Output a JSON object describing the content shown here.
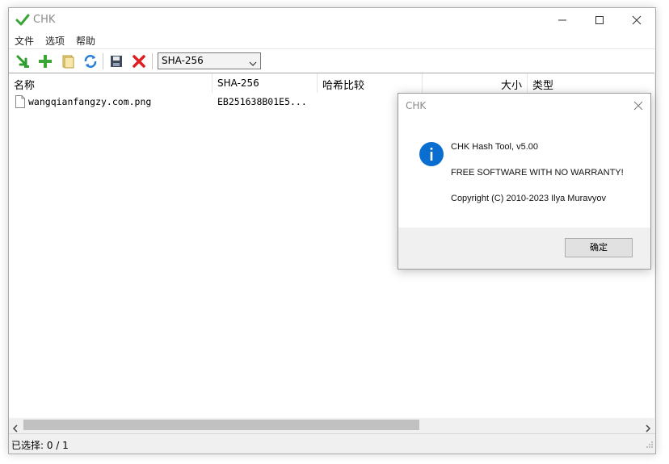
{
  "window": {
    "title": "CHK"
  },
  "menu": {
    "items": [
      "文件",
      "选项",
      "帮助"
    ]
  },
  "toolbar": {
    "buttons": [
      "open-icon",
      "add-icon",
      "folder-icon",
      "refresh-icon",
      "save-icon",
      "delete-icon"
    ],
    "algorithm_selected": "SHA-256"
  },
  "list": {
    "columns": [
      "名称",
      "SHA-256",
      "哈希比较",
      "大小",
      "类型"
    ],
    "rows": [
      {
        "name": "wangqianfangzy.com.png",
        "hash": "EB251638B01E5..."
      }
    ]
  },
  "status": {
    "text": "已选择: 0 / 1"
  },
  "dialog": {
    "title": "CHK",
    "line1": "CHK Hash Tool, v5.00",
    "line2": "FREE SOFTWARE WITH NO WARRANTY!",
    "line3": "Copyright (C) 2010-2023 Ilya Muravyov",
    "ok_label": "确定"
  },
  "colors": {
    "accent": "#0078d7",
    "checkmark": "#3aa63a",
    "delete_red": "#e02020"
  }
}
